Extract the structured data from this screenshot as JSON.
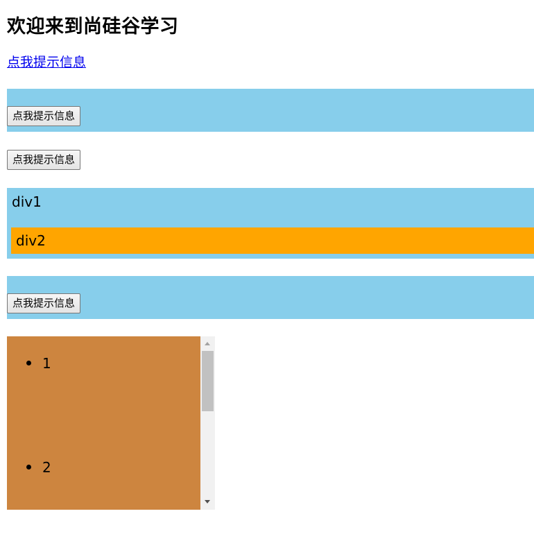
{
  "page": {
    "title": "欢迎来到尚硅谷学习",
    "link_label": "点我提示信息"
  },
  "blue_box_1": {
    "button_label": "点我提示信息"
  },
  "standalone_button": {
    "label": "点我提示信息"
  },
  "nested": {
    "div1_label": "div1",
    "div2_label": "div2"
  },
  "blue_box_2": {
    "button_label": "点我提示信息"
  },
  "scroll_list": {
    "items": [
      "1",
      "2"
    ]
  },
  "colors": {
    "skyblue": "#87ceeb",
    "orange": "#ffa500",
    "peru": "#cd853f",
    "link": "#0000ee"
  },
  "icons": {
    "bullet": "disc",
    "scroll_up": "triangle-up",
    "scroll_down": "triangle-down"
  }
}
